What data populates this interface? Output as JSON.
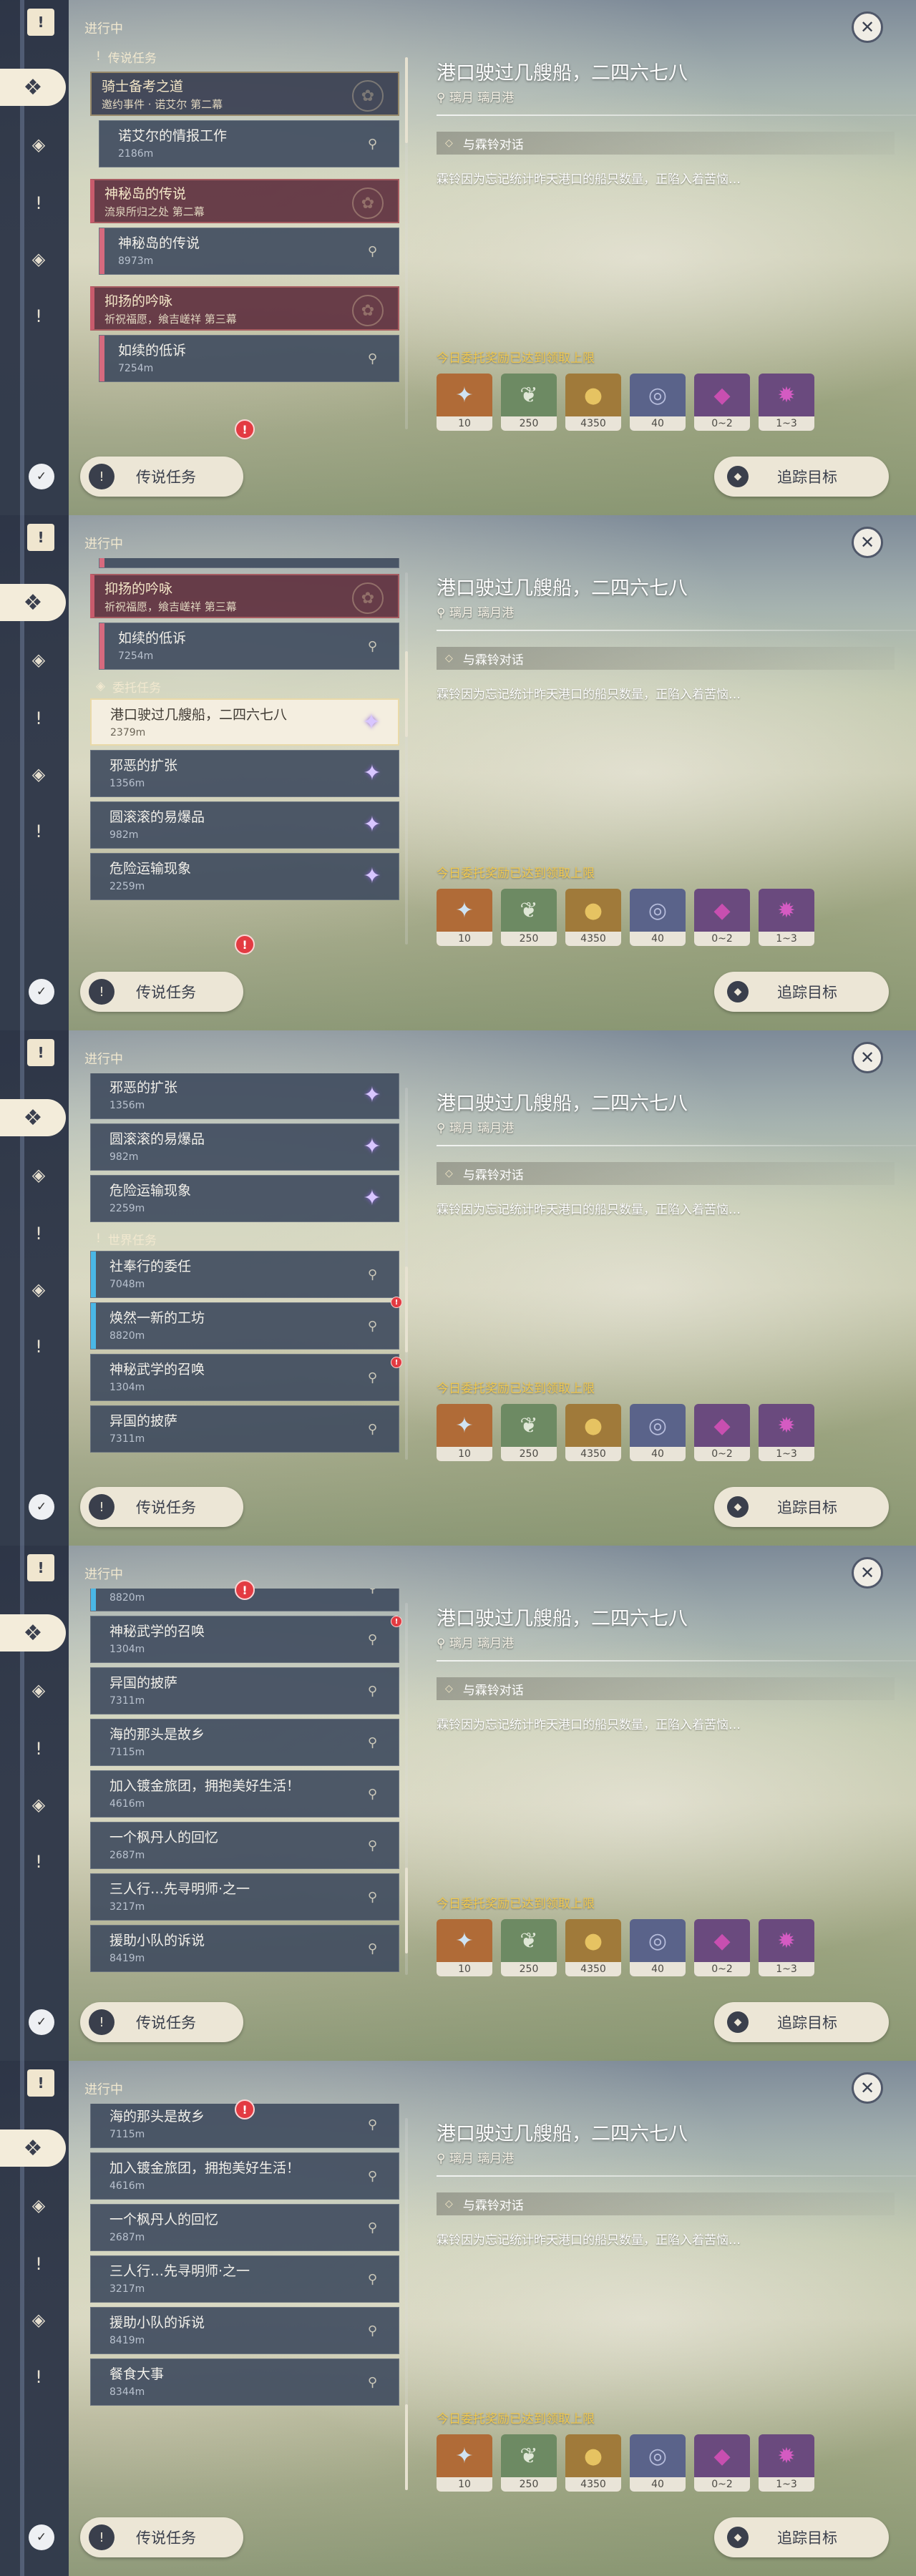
{
  "app": {
    "heading": "进行中",
    "close_icon_glyph": "✕",
    "nav": {
      "top_icon_glyph": "!",
      "items": [
        {
          "icon": "all-quests-icon",
          "glyph": "❖"
        },
        {
          "icon": "archon-quest-icon",
          "glyph": "◈"
        },
        {
          "icon": "legend-quest-icon",
          "glyph": "!"
        },
        {
          "icon": "commission-icon",
          "glyph": "◈"
        },
        {
          "icon": "world-quest-icon",
          "glyph": "!"
        }
      ],
      "bottom_icon_glyph": "✓"
    },
    "footer": {
      "left_label": "传说任务",
      "left_icon_glyph": "!",
      "right_label": "追踪目标",
      "right_icon_glyph": "◆"
    },
    "detail": {
      "title": "港口驶过几艘船，二四六七八",
      "location_icon": "map-pin-icon",
      "location": "璃月 璃月港",
      "objective_icon": "diamond-icon",
      "objective": "与霖铃对话",
      "description": "霖铃因为忘记统计昨天港口的船只数量，正陷入着苦恼…",
      "reward_label": "今日委托奖励已达到领取上限",
      "rewards": [
        {
          "icon": "adventure-exp-icon",
          "glyph": "✦",
          "count": "10",
          "color": "#b06b37"
        },
        {
          "icon": "companionship-exp-icon",
          "glyph": "❦",
          "count": "250",
          "color": "#6d8a63"
        },
        {
          "icon": "mora-icon",
          "glyph": "●",
          "count": "4350",
          "color": "#a07a3a"
        },
        {
          "icon": "wanderers-advice-icon",
          "glyph": "◎",
          "count": "40",
          "color": "#5a638a"
        },
        {
          "icon": "mystic-gem-fragment-icon",
          "glyph": "◆",
          "count": "0~2",
          "color": "#6a4a7e"
        },
        {
          "icon": "mystic-gem-crystal-icon",
          "glyph": "✹",
          "count": "1~3",
          "color": "#6a4a7e"
        }
      ]
    },
    "sections": {
      "legend": "传说任务",
      "commission": "委托任务",
      "world": "世界任务"
    },
    "quests": {
      "knight_group": {
        "title": "骑士备考之道",
        "subtitle": "邀约事件 · 诺艾尔 第二幕"
      },
      "noelle_info": {
        "title": "诺艾尔的情报工作",
        "distance": "2186m"
      },
      "mystery_group": {
        "title": "神秘岛的传说",
        "subtitle": "流泉所归之处 第二幕"
      },
      "mystery_island": {
        "title": "神秘岛的传说",
        "distance": "8973m"
      },
      "praise_group": {
        "title": "抑扬的吟咏",
        "subtitle": "祈祝福愿，飨吉嵯祥 第三幕"
      },
      "sorrow": {
        "title": "如续的低诉",
        "distance": "7254m"
      },
      "port_ships": {
        "title": "港口驶过几艘船，二四六七八",
        "distance": "2379m"
      },
      "evil_spread": {
        "title": "邪恶的扩张",
        "distance": "1356m"
      },
      "rolling_bomb": {
        "title": "圆滚滚的易爆品",
        "distance": "982m"
      },
      "danger_transport": {
        "title": "危险运输现象",
        "distance": "2259m"
      },
      "company_entrust": {
        "title": "社奉行的委任",
        "distance": "7048m"
      },
      "new_workshop": {
        "title": "焕然一新的工坊",
        "distance": "8820m"
      },
      "martial_call": {
        "title": "神秘武学的召唤",
        "distance": "1304m"
      },
      "foreign_cape": {
        "title": "异国的披萨",
        "distance": "7311m"
      },
      "homeland": {
        "title": "海的那头是故乡",
        "distance": "7115m"
      },
      "golden_troupe": {
        "title": "加入镀金旅团，拥抱美好生活！",
        "distance": "4616m"
      },
      "maple_memory": {
        "title": "一个枫丹人的回忆",
        "distance": "2687m"
      },
      "three_travel": {
        "title": "三人行…先寻明师·之一",
        "distance": "3217m"
      },
      "rescue_party": {
        "title": "援助小队的诉说",
        "distance": "8419m"
      },
      "feast": {
        "title": "餐食大事",
        "distance": "8344m"
      }
    }
  }
}
